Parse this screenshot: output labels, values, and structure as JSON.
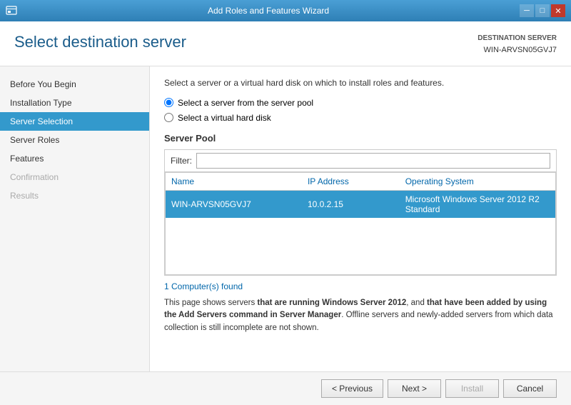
{
  "titlebar": {
    "title": "Add Roles and Features Wizard",
    "min_label": "─",
    "max_label": "□",
    "close_label": "✕"
  },
  "header": {
    "title": "Select destination server",
    "destination_label": "DESTINATION SERVER",
    "server_name": "WIN-ARVSN05GVJ7"
  },
  "sidebar": {
    "items": [
      {
        "id": "before-you-begin",
        "label": "Before You Begin",
        "state": "normal"
      },
      {
        "id": "installation-type",
        "label": "Installation Type",
        "state": "normal"
      },
      {
        "id": "server-selection",
        "label": "Server Selection",
        "state": "active"
      },
      {
        "id": "server-roles",
        "label": "Server Roles",
        "state": "normal"
      },
      {
        "id": "features",
        "label": "Features",
        "state": "normal"
      },
      {
        "id": "confirmation",
        "label": "Confirmation",
        "state": "disabled"
      },
      {
        "id": "results",
        "label": "Results",
        "state": "disabled"
      }
    ]
  },
  "content": {
    "description": "Select a server or a virtual hard disk on which to install roles and features.",
    "radio_options": [
      {
        "id": "server-pool",
        "label": "Select a server from the server pool",
        "checked": true
      },
      {
        "id": "virtual-disk",
        "label": "Select a virtual hard disk",
        "checked": false
      }
    ],
    "server_pool": {
      "section_title": "Server Pool",
      "filter_label": "Filter:",
      "filter_placeholder": "",
      "table_headers": [
        "Name",
        "IP Address",
        "Operating System"
      ],
      "table_rows": [
        {
          "name": "WIN-ARVSN05GVJ7",
          "ip": "10.0.2.15",
          "os": "Microsoft Windows Server 2012 R2 Standard",
          "selected": true
        }
      ]
    },
    "computers_found": "1 Computer(s) found",
    "info_text_parts": {
      "part1": "This page shows servers that are running Windows Server 2012, and ",
      "bold1": "that have been added by using the Add Servers command in Server Manager",
      "part2": ". Offline servers and newly-added servers from which data collection is still incomplete are not shown."
    }
  },
  "footer": {
    "previous_label": "< Previous",
    "next_label": "Next >",
    "install_label": "Install",
    "cancel_label": "Cancel"
  }
}
